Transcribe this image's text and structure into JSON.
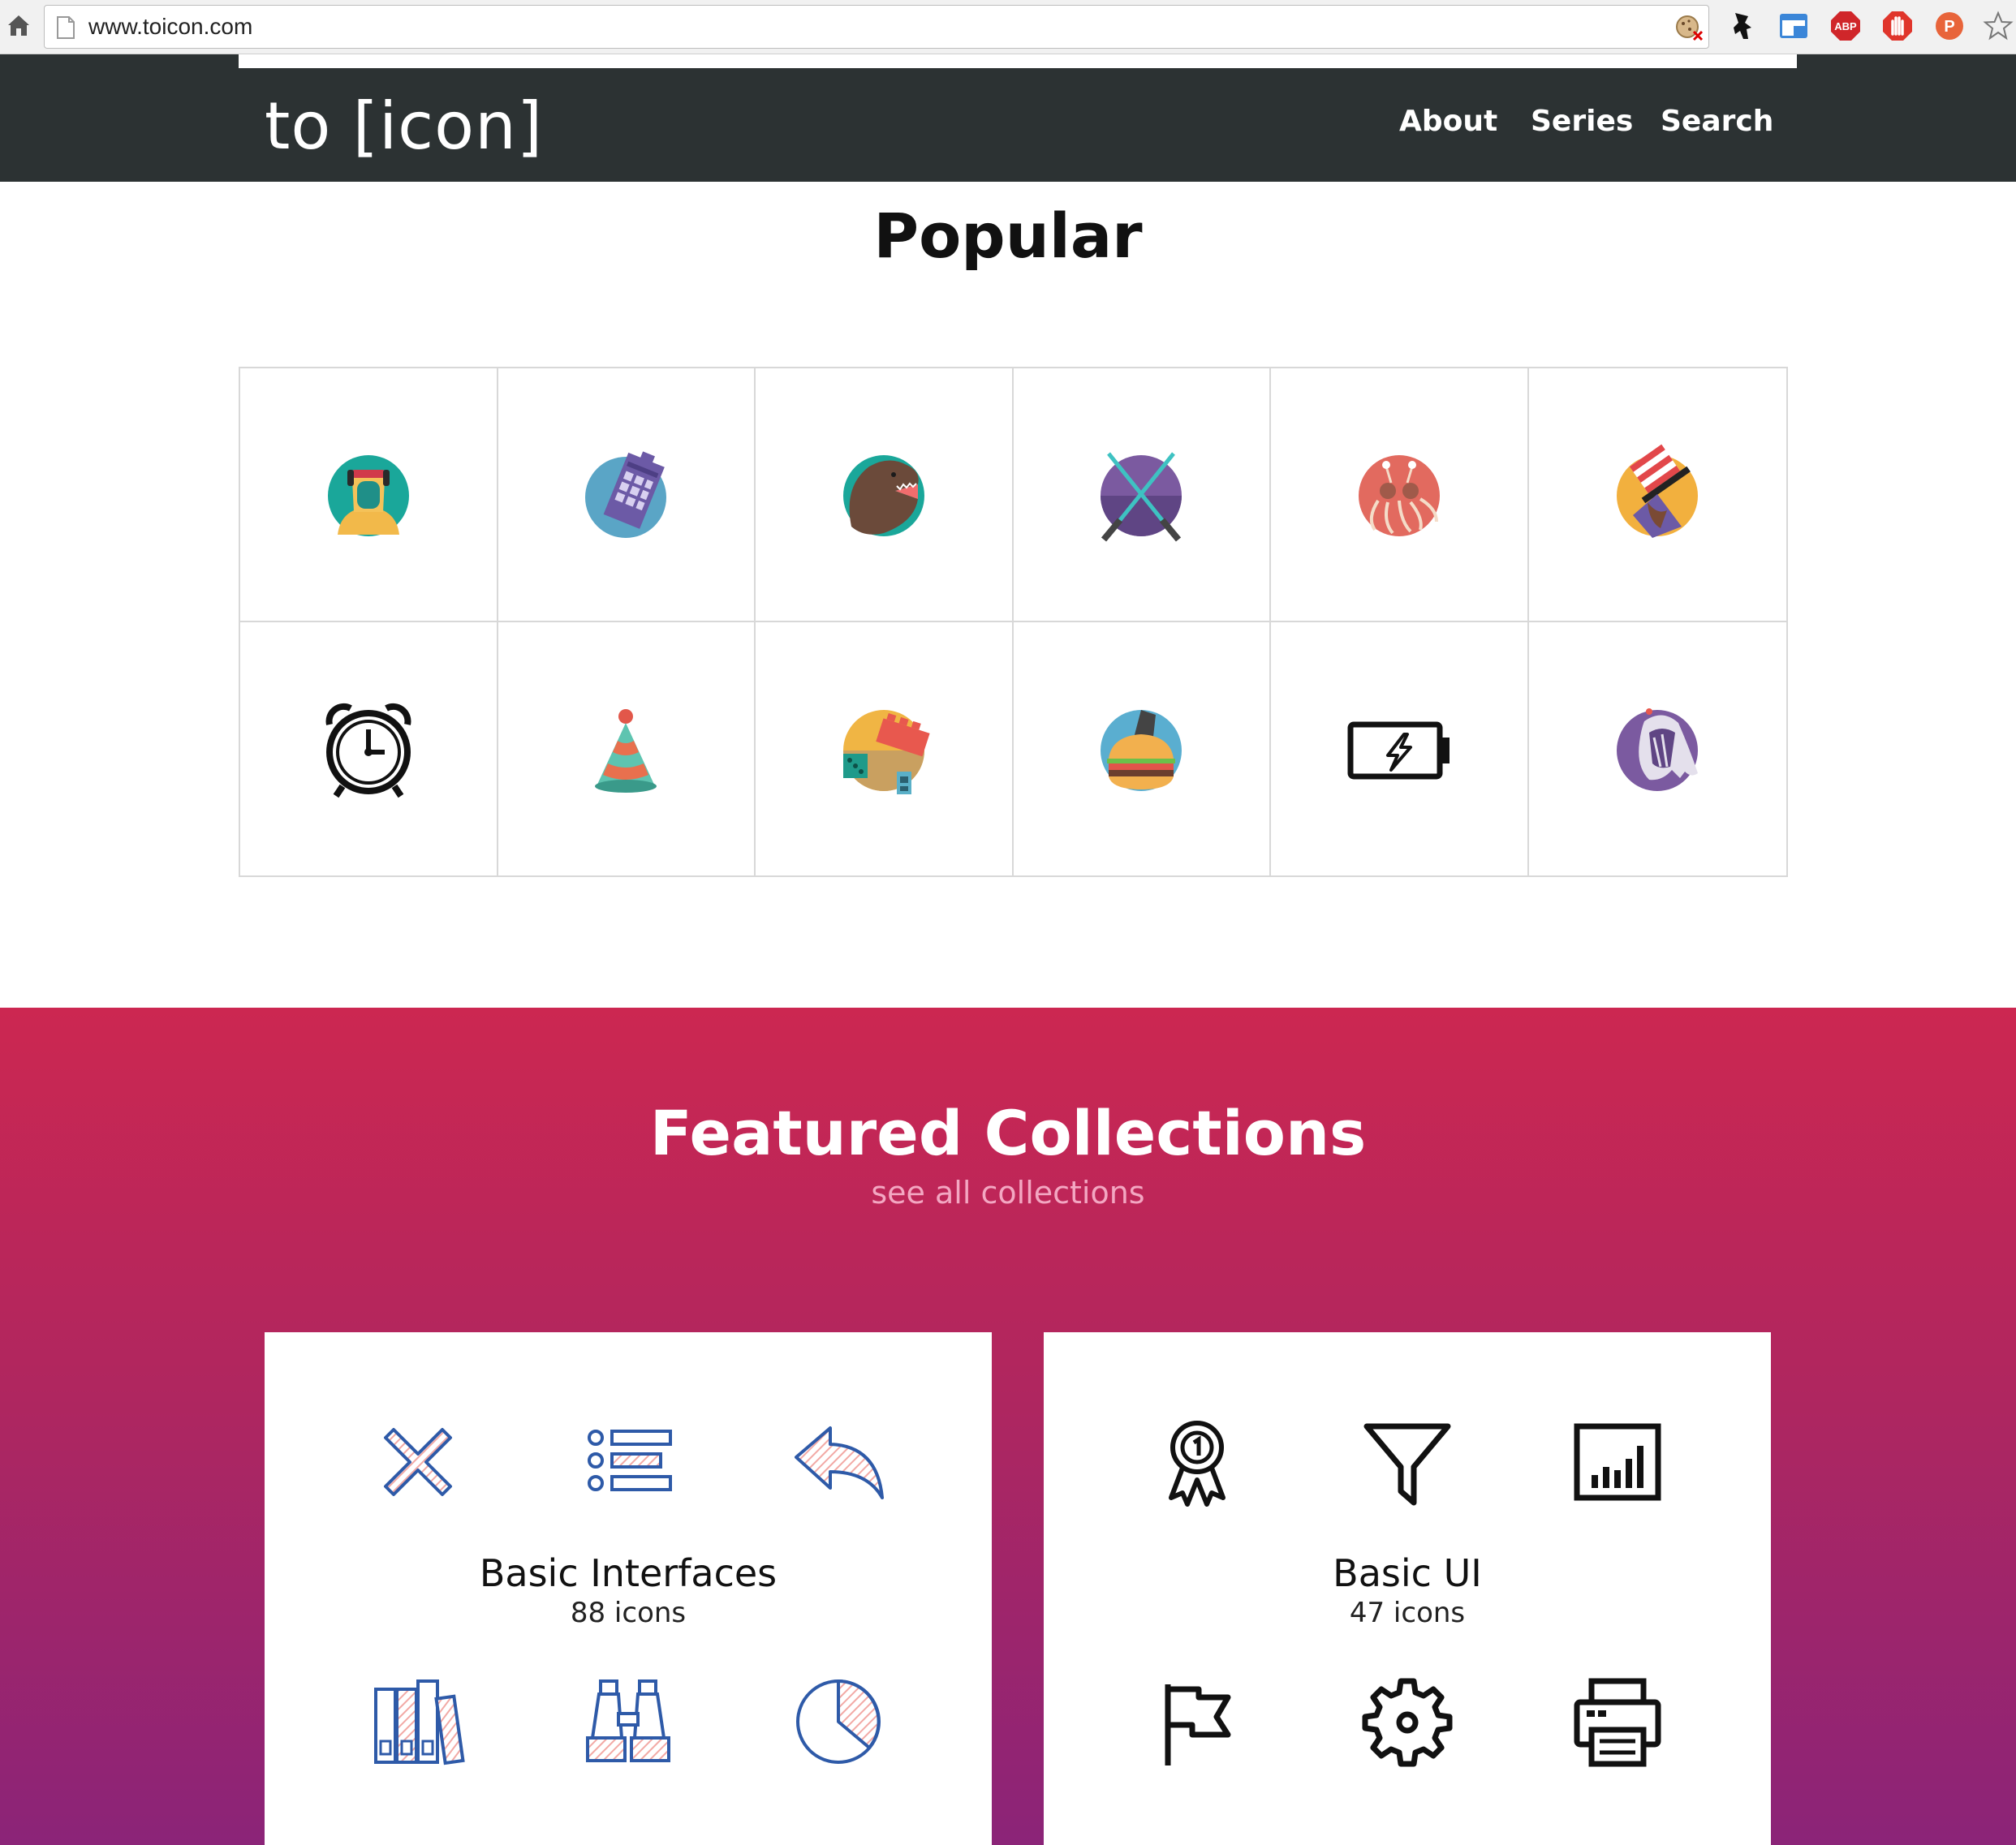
{
  "browser": {
    "url": "www.toicon.com",
    "extensions": [
      "ninja-icon",
      "window-icon",
      "adblock-plus-icon",
      "hand-stop-icon",
      "pocket-p-icon",
      "bookmark-star-icon"
    ],
    "abp_label": "ABP",
    "p_label": "P"
  },
  "header": {
    "logo": "to [icon]",
    "nav": [
      "About",
      "Series",
      "Search"
    ]
  },
  "popular": {
    "title": "Popular",
    "icons": [
      "hooded-astronaut-icon",
      "phone-booth-icon",
      "t-rex-icon",
      "crossed-lightsabers-icon",
      "spaghetti-monster-icon",
      "bandit-mask-icon",
      "alarm-clock-icon",
      "party-hat-icon",
      "toy-blocks-icon",
      "burger-icon",
      "battery-charging-icon",
      "ghost-bride-icon"
    ]
  },
  "featured": {
    "title": "Featured Collections",
    "link": "see all collections",
    "collections": [
      {
        "name": "Basic Interfaces",
        "count": "88 icons",
        "icons": [
          "close-x-icon",
          "list-icon",
          "reply-arrow-icon",
          "binders-icon",
          "binoculars-icon",
          "pie-chart-icon"
        ]
      },
      {
        "name": "Basic UI",
        "count": "47 icons",
        "icons": [
          "award-ribbon-icon",
          "filter-funnel-icon",
          "bar-chart-icon",
          "flag-icon",
          "gear-icon",
          "printer-icon"
        ]
      }
    ]
  },
  "colors": {
    "header_bg": "#2c3233",
    "featured_top": "#cc2751",
    "featured_bottom": "#8b2478",
    "outline_blue": "#2e5aa8",
    "hatch_pink": "#f2a9a5"
  }
}
